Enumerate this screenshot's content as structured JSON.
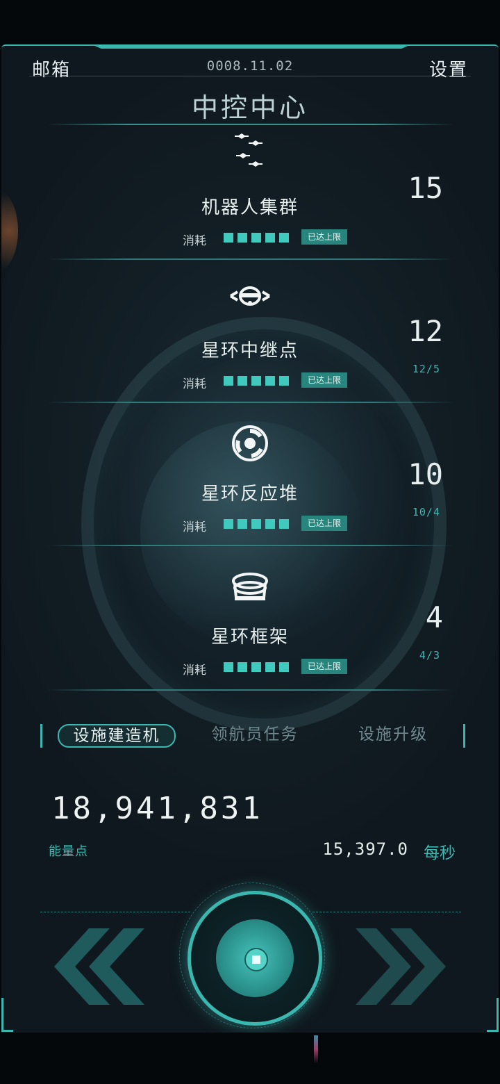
{
  "header": {
    "mailbox_label": "邮箱",
    "date": "0008.11.02",
    "settings_label": "设置"
  },
  "page_title": "中控中心",
  "facilities": [
    {
      "name": "机器人集群",
      "count": "15",
      "sub": "",
      "cost_label": "消耗",
      "badge": "已达上限",
      "icon": "robot-swarm-icon"
    },
    {
      "name": "星环中继点",
      "count": "12",
      "sub": "12/5",
      "cost_label": "消耗",
      "badge": "已达上限",
      "icon": "relay-station-icon"
    },
    {
      "name": "星环反应堆",
      "count": "10",
      "sub": "10/4",
      "cost_label": "消耗",
      "badge": "已达上限",
      "icon": "reactor-icon"
    },
    {
      "name": "星环框架",
      "count": "4",
      "sub": "4/3",
      "cost_label": "消耗",
      "badge": "已达上限",
      "icon": "ring-frame-icon"
    }
  ],
  "tabs": {
    "active": "设施建造机",
    "second": "领航员任务",
    "third": "设施升级"
  },
  "energy": {
    "value": "18,941,831",
    "label": "能量点",
    "rate": "15,397.0",
    "rate_unit": "每秒"
  },
  "colors": {
    "accent": "#3ab8b0",
    "badge": "#27857e",
    "background": "#121d24"
  }
}
